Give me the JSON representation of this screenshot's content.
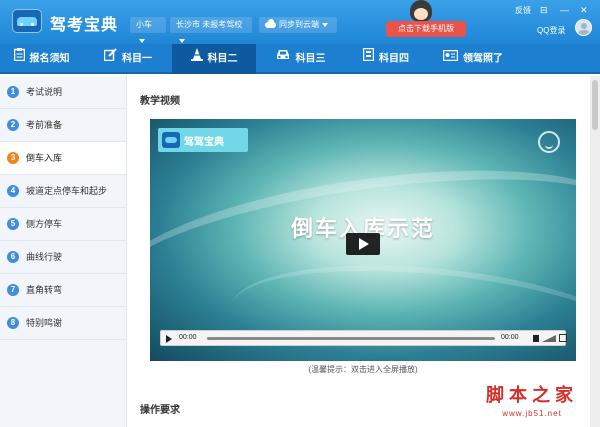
{
  "app": {
    "title": "驾考宝典",
    "car_type": "小车",
    "city_school": "长沙市 未报考驾校",
    "sync": "同步到云端",
    "download_btn": "点击下载手机版",
    "feedback": "反馈",
    "win_menu": "⊟",
    "win_min": "—",
    "win_close": "✕",
    "login": "QQ登录"
  },
  "nav": {
    "tabs": [
      {
        "label": "报名须知",
        "icon": "clipboard-icon"
      },
      {
        "label": "科目一",
        "icon": "pencil-icon"
      },
      {
        "label": "科目二",
        "icon": "traffic-cone-icon",
        "active": true
      },
      {
        "label": "科目三",
        "icon": "car-icon"
      },
      {
        "label": "科目四",
        "icon": "document-icon"
      },
      {
        "label": "领驾照了",
        "icon": "id-card-icon"
      }
    ]
  },
  "sidebar": {
    "items": [
      {
        "num": "1",
        "label": "考试说明"
      },
      {
        "num": "2",
        "label": "考前准备"
      },
      {
        "num": "3",
        "label": "倒车入库",
        "active": true
      },
      {
        "num": "4",
        "label": "坡道定点停车和起步"
      },
      {
        "num": "5",
        "label": "侧方停车"
      },
      {
        "num": "6",
        "label": "曲线行驶"
      },
      {
        "num": "7",
        "label": "直角转弯"
      },
      {
        "num": "8",
        "label": "特别鸣谢"
      }
    ]
  },
  "main": {
    "video_section_title": "教学视频",
    "video": {
      "logo_text": "驾驾宝典",
      "title": "倒车入库示范",
      "time_current": "00:00",
      "time_total": "00:00"
    },
    "hint": "(温馨提示：双击进入全屏播放)",
    "requirements_title": "操作要求"
  },
  "watermark": {
    "text": "脚本之家",
    "url": "www.jb51.net"
  },
  "colors": {
    "header": "#1f86d6",
    "nav": "#1d7fd0",
    "active_tab": "#0d5aa0",
    "step_badge": "#3f8ede",
    "active_badge": "#f0841e",
    "download_btn": "#e8534c",
    "watermark": "#d42f2a"
  }
}
